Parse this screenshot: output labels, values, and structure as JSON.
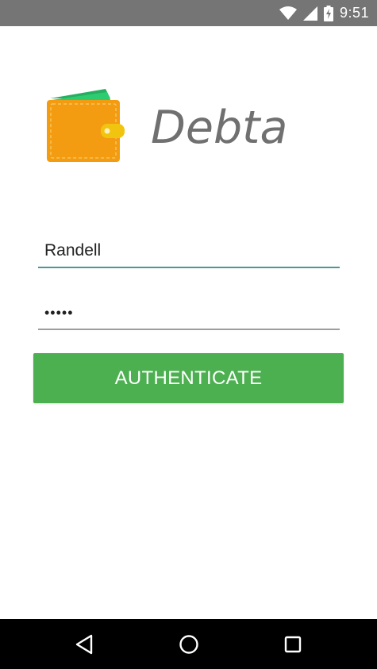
{
  "status_bar": {
    "time": "9:51",
    "icons": [
      "wifi-icon",
      "signal-icon",
      "battery-charging-icon"
    ]
  },
  "app": {
    "title": "Debta",
    "logo_icon": "wallet-icon"
  },
  "login": {
    "username": {
      "value": "Randell"
    },
    "password": {
      "value": "•••••"
    },
    "submit_label": "AUTHENTICATE"
  },
  "navigation": {
    "icons": [
      "back-icon",
      "home-icon",
      "recents-icon"
    ]
  },
  "colors": {
    "status_bar": "#757575",
    "accent": "#4caf50",
    "focus_underline": "#4a9a93",
    "title_text": "#707070",
    "wallet_body": "#f39c12",
    "wallet_bills": "#2ecc71",
    "nav_bar": "#000000"
  }
}
